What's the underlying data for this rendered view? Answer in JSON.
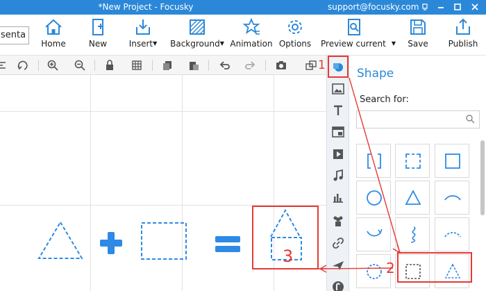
{
  "window": {
    "title": "*New Project - Focusky",
    "email": "support@focusky.com",
    "buttons": [
      "help-icon",
      "minimize-icon",
      "maximize-icon",
      "close-icon"
    ]
  },
  "project_tab": {
    "label": "senta"
  },
  "ribbon": {
    "items": [
      {
        "label": "Home",
        "icon": "home-icon"
      },
      {
        "label": "New",
        "icon": "new-page-icon"
      },
      {
        "label": "Insert",
        "icon": "insert-icon",
        "dropdown": true
      },
      {
        "label": "Background",
        "icon": "background-icon",
        "dropdown": true
      },
      {
        "label": "Animation",
        "icon": "animation-icon"
      },
      {
        "label": "Options",
        "icon": "gear-icon"
      },
      {
        "label": "Preview current",
        "icon": "preview-icon",
        "dropdown": true
      },
      {
        "label": "Save",
        "icon": "save-icon"
      },
      {
        "label": "Publish",
        "icon": "publish-icon"
      }
    ]
  },
  "toolbar": {
    "icons": [
      "align-icon",
      "rotate-icon",
      "zoom-in-icon",
      "zoom-out-icon",
      "lock-icon",
      "grid-icon",
      "copy-icon",
      "paste-icon",
      "undo-icon",
      "redo-icon",
      "screenshot-icon",
      "frame-icon"
    ]
  },
  "side_strip": {
    "icons": [
      "shape-icon",
      "image-icon",
      "text-icon",
      "layout-icon",
      "video-icon",
      "music-icon",
      "chart-icon",
      "people-icon",
      "link-icon",
      "plane-icon",
      "more-icon"
    ],
    "active": "shape-icon"
  },
  "panel": {
    "title": "Shape",
    "search_label": "Search for:",
    "search_value": "",
    "shapes": [
      "bracket-shape",
      "dashed-corners-shape",
      "square-shape",
      "circle-shape",
      "triangle-shape",
      "arc-shape",
      "curved-arrow-shape",
      "squiggle-shape",
      "dashed-arc-shape",
      "dashed-circle-shape",
      "dashed-square-shape",
      "dashed-triangle-shape"
    ]
  },
  "annotations": {
    "step1": "1",
    "step2": "2",
    "step3": "3",
    "color": "#e53935"
  },
  "colors": {
    "accent": "#2b88d8",
    "shape_blue": "#2e8ae6",
    "annotation_red": "#e53935"
  }
}
